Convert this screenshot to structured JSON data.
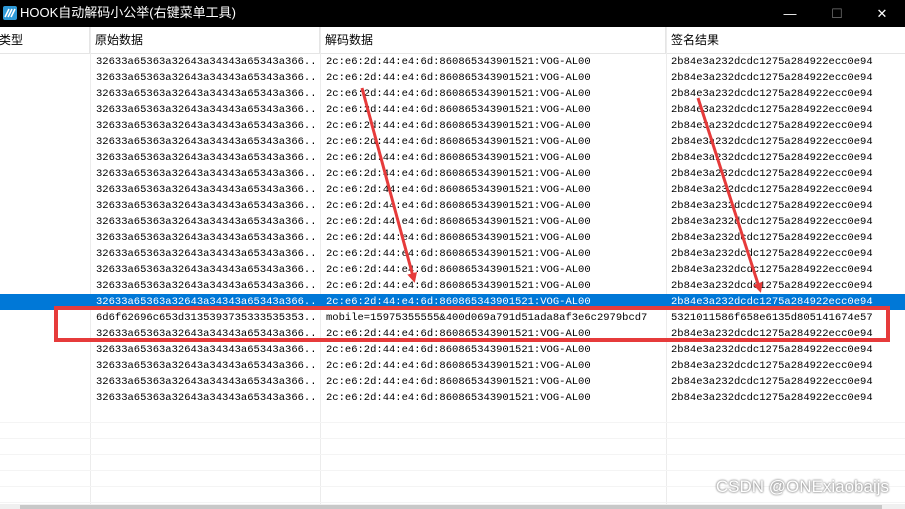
{
  "window": {
    "title": "HOOK自动解码小公举(右键菜单工具)",
    "minimize_glyph": "—",
    "maximize_glyph": "☐",
    "close_glyph": "✕",
    "icon": "app-logo-icon"
  },
  "table": {
    "columns": [
      "类型",
      "原始数据",
      "解码数据",
      "签名结果"
    ],
    "rows": [
      [
        "",
        "32633a65363a32643a34343a65343a366...",
        "2c:e6:2d:44:e4:6d:860865343901521:VOG-AL00",
        "2b84e3a232dcdc1275a284922ecc0e94"
      ],
      [
        "",
        "32633a65363a32643a34343a65343a366...",
        "2c:e6:2d:44:e4:6d:860865343901521:VOG-AL00",
        "2b84e3a232dcdc1275a284922ecc0e94"
      ],
      [
        "",
        "32633a65363a32643a34343a65343a366...",
        "2c:e6:2d:44:e4:6d:860865343901521:VOG-AL00",
        "2b84e3a232dcdc1275a284922ecc0e94"
      ],
      [
        "",
        "32633a65363a32643a34343a65343a366...",
        "2c:e6:2d:44:e4:6d:860865343901521:VOG-AL00",
        "2b84e3a232dcdc1275a284922ecc0e94"
      ],
      [
        "",
        "32633a65363a32643a34343a65343a366...",
        "2c:e6:2d:44:e4:6d:860865343901521:VOG-AL00",
        "2b84e3a232dcdc1275a284922ecc0e94"
      ],
      [
        "",
        "32633a65363a32643a34343a65343a366...",
        "2c:e6:2d:44:e4:6d:860865343901521:VOG-AL00",
        "2b84e3a232dcdc1275a284922ecc0e94"
      ],
      [
        "",
        "32633a65363a32643a34343a65343a366...",
        "2c:e6:2d:44:e4:6d:860865343901521:VOG-AL00",
        "2b84e3a232dcdc1275a284922ecc0e94"
      ],
      [
        "",
        "32633a65363a32643a34343a65343a366...",
        "2c:e6:2d:44:e4:6d:860865343901521:VOG-AL00",
        "2b84e3a232dcdc1275a284922ecc0e94"
      ],
      [
        "",
        "32633a65363a32643a34343a65343a366...",
        "2c:e6:2d:44:e4:6d:860865343901521:VOG-AL00",
        "2b84e3a232dcdc1275a284922ecc0e94"
      ],
      [
        "",
        "32633a65363a32643a34343a65343a366...",
        "2c:e6:2d:44:e4:6d:860865343901521:VOG-AL00",
        "2b84e3a232dcdc1275a284922ecc0e94"
      ],
      [
        "",
        "32633a65363a32643a34343a65343a366...",
        "2c:e6:2d:44:e4:6d:860865343901521:VOG-AL00",
        "2b84e3a232dcdc1275a284922ecc0e94"
      ],
      [
        "",
        "32633a65363a32643a34343a65343a366...",
        "2c:e6:2d:44:e4:6d:860865343901521:VOG-AL00",
        "2b84e3a232dcdc1275a284922ecc0e94"
      ],
      [
        "",
        "32633a65363a32643a34343a65343a366...",
        "2c:e6:2d:44:e4:6d:860865343901521:VOG-AL00",
        "2b84e3a232dcdc1275a284922ecc0e94"
      ],
      [
        "",
        "32633a65363a32643a34343a65343a366...",
        "2c:e6:2d:44:e4:6d:860865343901521:VOG-AL00",
        "2b84e3a232dcdc1275a284922ecc0e94"
      ],
      [
        "",
        "32633a65363a32643a34343a65343a366...",
        "2c:e6:2d:44:e4:6d:860865343901521:VOG-AL00",
        "2b84e3a232dcdc1275a284922ecc0e94"
      ],
      [
        "",
        "32633a65363a32643a34343a65343a366...",
        "2c:e6:2d:44:e4:6d:860865343901521:VOG-AL00",
        "2b84e3a232dcdc1275a284922ecc0e94"
      ],
      [
        "",
        "6d6f62696c653d3135393735333535353...",
        "mobile=15975355555&400d069a791d51ada8af3e6c2979bcd7",
        "5321011586f658e6135d805141674e57"
      ],
      [
        "",
        "32633a65363a32643a34343a65343a366...",
        "2c:e6:2d:44:e4:6d:860865343901521:VOG-AL00",
        "2b84e3a232dcdc1275a284922ecc0e94"
      ],
      [
        "",
        "32633a65363a32643a34343a65343a366...",
        "2c:e6:2d:44:e4:6d:860865343901521:VOG-AL00",
        "2b84e3a232dcdc1275a284922ecc0e94"
      ],
      [
        "",
        "32633a65363a32643a34343a65343a366...",
        "2c:e6:2d:44:e4:6d:860865343901521:VOG-AL00",
        "2b84e3a232dcdc1275a284922ecc0e94"
      ],
      [
        "",
        "32633a65363a32643a34343a65343a366...",
        "2c:e6:2d:44:e4:6d:860865343901521:VOG-AL00",
        "2b84e3a232dcdc1275a284922ecc0e94"
      ],
      [
        "",
        "32633a65363a32643a34343a65343a366...",
        "2c:e6:2d:44:e4:6d:860865343901521:VOG-AL00",
        "2b84e3a232dcdc1275a284922ecc0e94"
      ]
    ],
    "selected_row": 15,
    "empty_rows": 6
  },
  "annotations": {
    "highlight_color": "#e63b3b",
    "arrow_color": "#e63b3b"
  },
  "watermark": "CSDN @ONExiaobaijs",
  "colors": {
    "titlebar": "#000000",
    "selection": "#0078d7"
  }
}
